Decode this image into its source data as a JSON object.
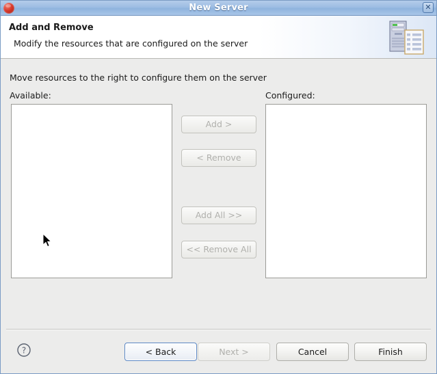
{
  "window": {
    "title": "New Server",
    "app_icon": "red-sphere-icon",
    "close_label": "✕"
  },
  "header": {
    "title": "Add and Remove",
    "subtitle": "Modify the resources that are configured on the server",
    "banner_icon": "server-and-document-icon"
  },
  "main": {
    "instruction": "Move resources to the right to configure them on the server",
    "available_label": "Available:",
    "configured_label": "Configured:",
    "available_items": [],
    "configured_items": [],
    "transfer_buttons": [
      {
        "label": "Add >",
        "enabled": false
      },
      {
        "label": "< Remove",
        "enabled": false
      },
      {
        "label": "Add All >>",
        "enabled": false
      },
      {
        "label": "<< Remove All",
        "enabled": false
      }
    ]
  },
  "footer": {
    "help_icon": "question-mark-icon",
    "buttons": [
      {
        "label": "< Back",
        "enabled": true,
        "focused": true
      },
      {
        "label": "Next >",
        "enabled": false,
        "focused": false
      },
      {
        "label": "Cancel",
        "enabled": true,
        "focused": false
      },
      {
        "label": "Finish",
        "enabled": true,
        "focused": false
      }
    ]
  },
  "colors": {
    "titlebar_blue": "#9dbde3",
    "dialog_bg": "#ececeb",
    "listbox_bg": "#ffffff",
    "disabled_text": "#b0b0ac",
    "focus_border": "#5b87c4",
    "app_icon_red": "#d8392c"
  }
}
